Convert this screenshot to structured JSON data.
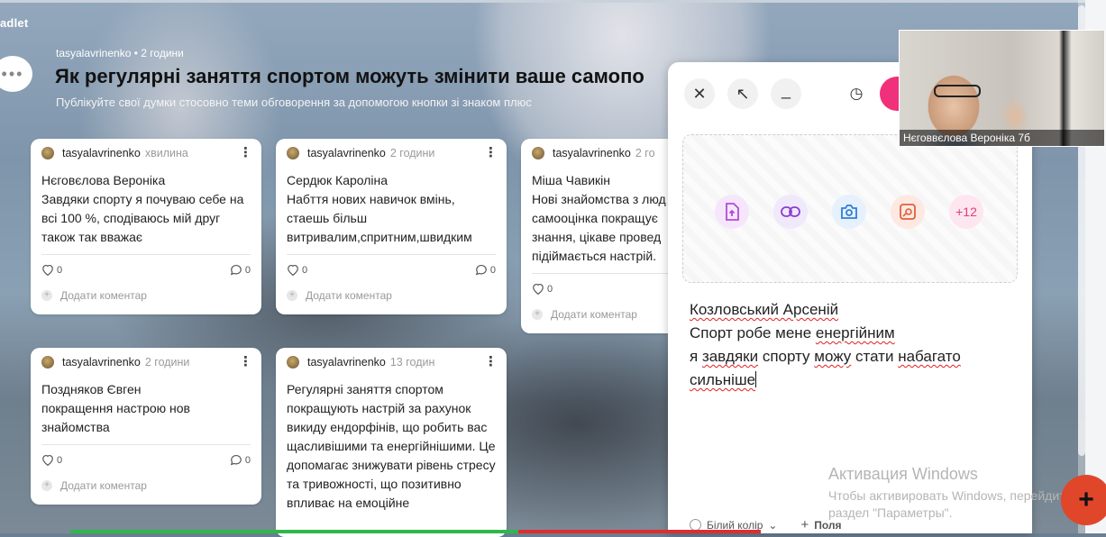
{
  "brand": "adlet",
  "chat_icon": "chat-bubble-icon",
  "board": {
    "author": "tasyalavrinenko",
    "dot": "•",
    "time": "2 години",
    "title": "Як регулярні заняття спортом можуть змінити ваше самопо",
    "subtitle": "Публікуйте свої думки стосовно теми обговорення за допомогою кнопки зі знаком плюс"
  },
  "posts": [
    {
      "author": "tasyalavrinenko",
      "time": "хвилина",
      "body": "Нєговєлова Вероніка\nЗавдяки спорту я почуваю себе на всі 100 %, сподіваюсь мій друг також так вважає",
      "likes": "0",
      "comments": "0",
      "add_comment": "Додати коментар"
    },
    {
      "author": "tasyalavrinenko",
      "time": "2 години",
      "body": "Сердюк Кароліна\nНабття нових навичок вмінь, стаешь більш витривалим,спритним,швидким",
      "likes": "0",
      "comments": "0",
      "add_comment": "Додати коментар"
    },
    {
      "author": "tasyalavrinenko",
      "time": "2 го",
      "body": "Міша Чавикін\nНові знайомства з люд самооцінка покращує знання, цікаве провед підіймається настрій.",
      "likes": "0",
      "comments": "",
      "add_comment": "Додати коментар"
    },
    {
      "author": "tasyalavrinenko",
      "time": "2 години",
      "body": "Поздняков Євген\nпокращення настрою нов знайомства",
      "likes": "0",
      "comments": "0",
      "add_comment": "Додати коментар"
    },
    {
      "author": "tasyalavrinenko",
      "time": "13 годин",
      "body": "Регулярні заняття спортом покращують настрій за рахунок викиду ендорфінів, що робить вас щасливішими та енергійнішими. Це допомагає знижувати рівень стресу та тривожності, що позитивно впливає на емоційне",
      "likes": "",
      "comments": "",
      "add_comment": ""
    }
  ],
  "composer": {
    "close_icon": "close-icon",
    "expand_icon": "expand-arrow-icon",
    "minimize_icon": "minimize-icon",
    "schedule_icon": "schedule-clock-icon",
    "tools": [
      {
        "icon": "upload-file-icon",
        "label": "",
        "color": "#b24bd6",
        "bg": "#f6e6fb"
      },
      {
        "icon": "link-icon",
        "label": "",
        "color": "#8b3fd1",
        "bg": "#f0e8fb"
      },
      {
        "icon": "camera-icon",
        "label": "",
        "color": "#2f7fd8",
        "bg": "#e6f1fc"
      },
      {
        "icon": "image-search-icon",
        "label": "",
        "color": "#e0603a",
        "bg": "#fde9e2"
      },
      {
        "icon": "more-icon",
        "label": "+12",
        "color": "#e0407a",
        "bg": "#fde6ef"
      }
    ],
    "text": {
      "line1": "Козловський Арсеній",
      "line2_a": "Спорт робе мене ",
      "line2_b": "енергійним",
      "line3_a": "я ",
      "line3_b": "завдяки",
      "line3_c": " спорту ",
      "line3_d": "можу",
      "line3_e": " стати ",
      "line3_f": "набагато",
      "line4": "сильніше"
    },
    "footer": {
      "color_label": "Білий колір",
      "fields_label": "Поля"
    }
  },
  "activation": {
    "title": "Активация Windows",
    "line1": "Чтобы активировать Windows, перейдите в",
    "line2": "раздел \"Параметры\"."
  },
  "video": {
    "label": "Нєговвєлова Вероніка 7б"
  },
  "fab": {
    "label": "+"
  },
  "colors": {
    "accent": "#f0307a",
    "fab": "#e0462a",
    "progress_green": "#2fb84a",
    "progress_red": "#e02d2d"
  }
}
